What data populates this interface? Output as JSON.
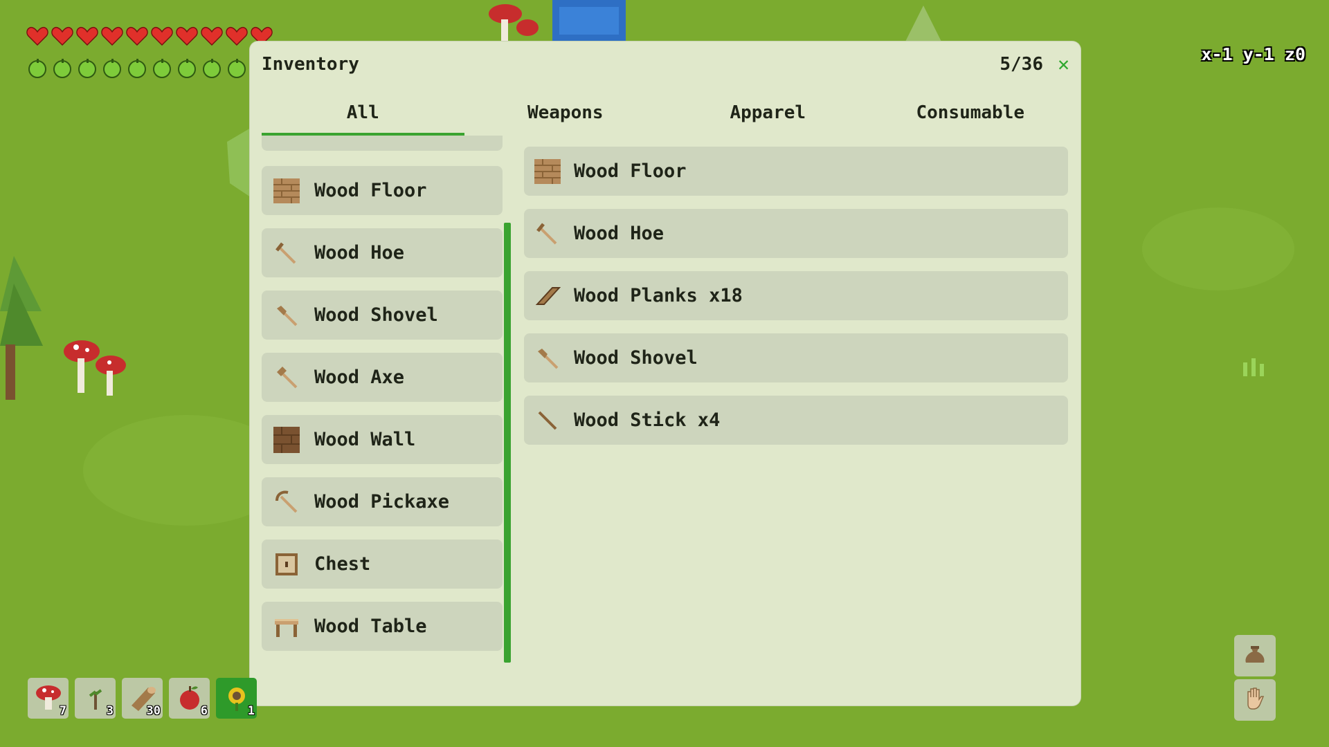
{
  "hud": {
    "hearts": 10,
    "food": 9,
    "coords": "x-1 y-1 z0"
  },
  "inventory": {
    "title": "Inventory",
    "count": "5/36",
    "close": "✕",
    "tabs": [
      {
        "label": "All",
        "active": true
      },
      {
        "label": "Weapons",
        "active": false
      },
      {
        "label": "Apparel",
        "active": false
      },
      {
        "label": "Consumable",
        "active": false
      }
    ],
    "recipe_list": [
      {
        "label": "Wood Floor",
        "icon": "wood-floor-icon"
      },
      {
        "label": "Wood Hoe",
        "icon": "wood-hoe-icon"
      },
      {
        "label": "Wood Shovel",
        "icon": "wood-shovel-icon"
      },
      {
        "label": "Wood Axe",
        "icon": "wood-axe-icon"
      },
      {
        "label": "Wood Wall",
        "icon": "wood-wall-icon"
      },
      {
        "label": "Wood Pickaxe",
        "icon": "wood-pickaxe-icon"
      },
      {
        "label": "Chest",
        "icon": "chest-icon"
      },
      {
        "label": "Wood Table",
        "icon": "wood-table-icon"
      }
    ],
    "items": [
      {
        "label": "Wood Floor",
        "icon": "wood-floor-icon"
      },
      {
        "label": "Wood Hoe",
        "icon": "wood-hoe-icon"
      },
      {
        "label": "Wood Planks x18",
        "icon": "wood-planks-icon"
      },
      {
        "label": "Wood Shovel",
        "icon": "wood-shovel-icon"
      },
      {
        "label": "Wood Stick x4",
        "icon": "wood-stick-icon"
      }
    ]
  },
  "hotbar": [
    {
      "icon": "mushroom-icon",
      "count": "7"
    },
    {
      "icon": "sapling-icon",
      "count": "3"
    },
    {
      "icon": "log-icon",
      "count": "30"
    },
    {
      "icon": "apple-icon",
      "count": "6"
    },
    {
      "icon": "sunflower-icon",
      "count": "1",
      "selected": true
    }
  ],
  "side_buttons": [
    {
      "icon": "bag-icon"
    },
    {
      "icon": "hand-icon"
    }
  ],
  "colors": {
    "grass": "#7bab2f",
    "panel": "#e0e8cb",
    "item": "#cdd5bd",
    "accent": "#3aa330",
    "heart": "#e0302a",
    "food": "#7ecb3a"
  }
}
